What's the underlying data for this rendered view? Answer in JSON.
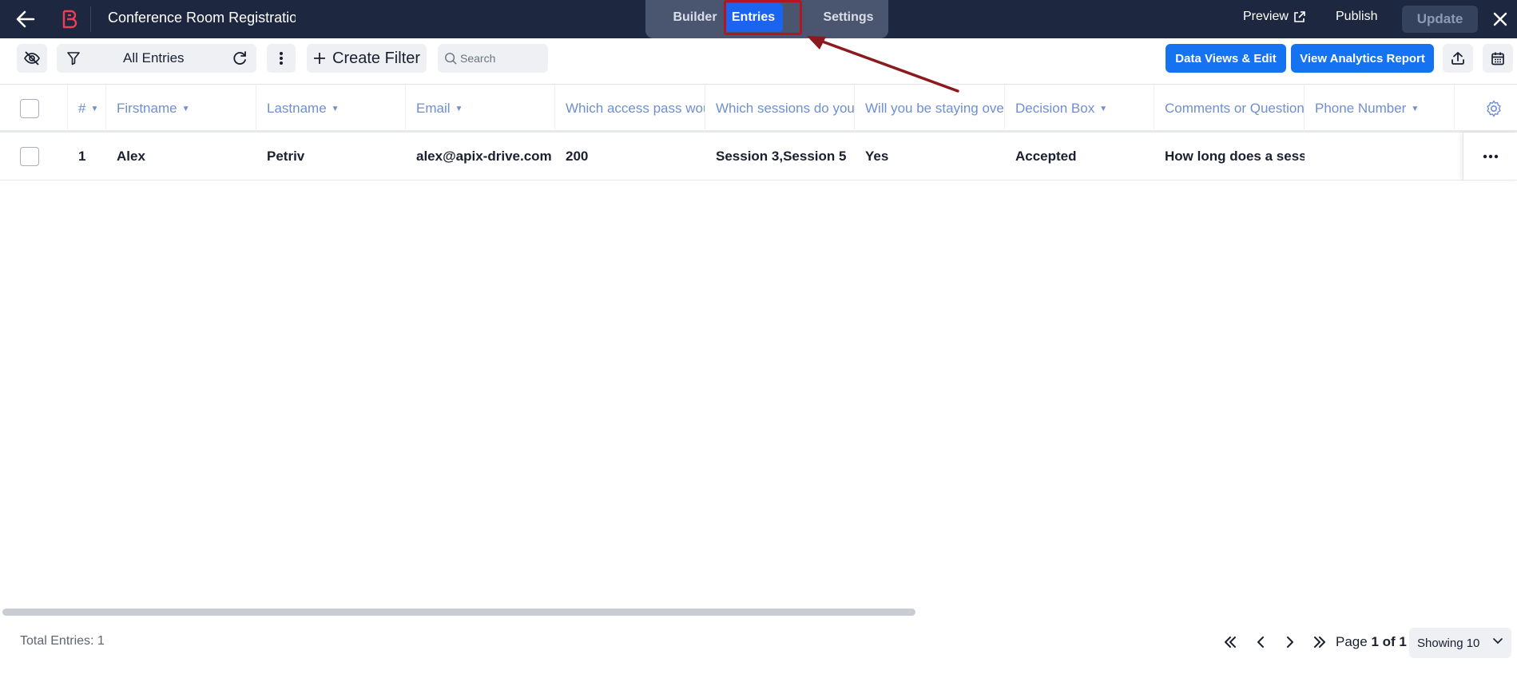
{
  "topbar": {
    "title": "Conference Room Registratior",
    "tabs": [
      {
        "label": "Builder"
      },
      {
        "label": "Entries"
      },
      {
        "label": "Settings"
      }
    ],
    "preview_label": "Preview",
    "publish_label": "Publish",
    "update_label": "Update"
  },
  "toolbar": {
    "filter_label": "All Entries",
    "create_filter_label": "Create Filter",
    "search_placeholder": "Search",
    "data_views_label": "Data Views & Edit",
    "analytics_label": "View Analytics Report"
  },
  "table": {
    "columns": [
      {
        "label": "#"
      },
      {
        "label": "Firstname"
      },
      {
        "label": "Lastname"
      },
      {
        "label": "Email"
      },
      {
        "label": "Which access pass wou"
      },
      {
        "label": "Which sessions do you"
      },
      {
        "label": "Will you be staying ove"
      },
      {
        "label": "Decision Box"
      },
      {
        "label": "Comments or Question"
      },
      {
        "label": "Phone Number"
      }
    ],
    "rows": [
      {
        "num": "1",
        "firstname": "Alex",
        "lastname": "Petriv",
        "email": "alex@apix-drive.com",
        "access_pass": "200",
        "sessions": "Session 3,Session 5",
        "staying": "Yes",
        "decision": "Accepted",
        "comments": "How long does a sessic",
        "phone": ""
      }
    ]
  },
  "footer": {
    "total_label": "Total Entries: 1",
    "page_prefix": "Page",
    "page_value": "1 of 1",
    "showing_label": "Showing 10"
  },
  "colors": {
    "topbar_bg": "#1d2740",
    "active_tab": "#1a64f0",
    "primary_button": "#1572f0",
    "annotation": "#8b1a1f"
  }
}
